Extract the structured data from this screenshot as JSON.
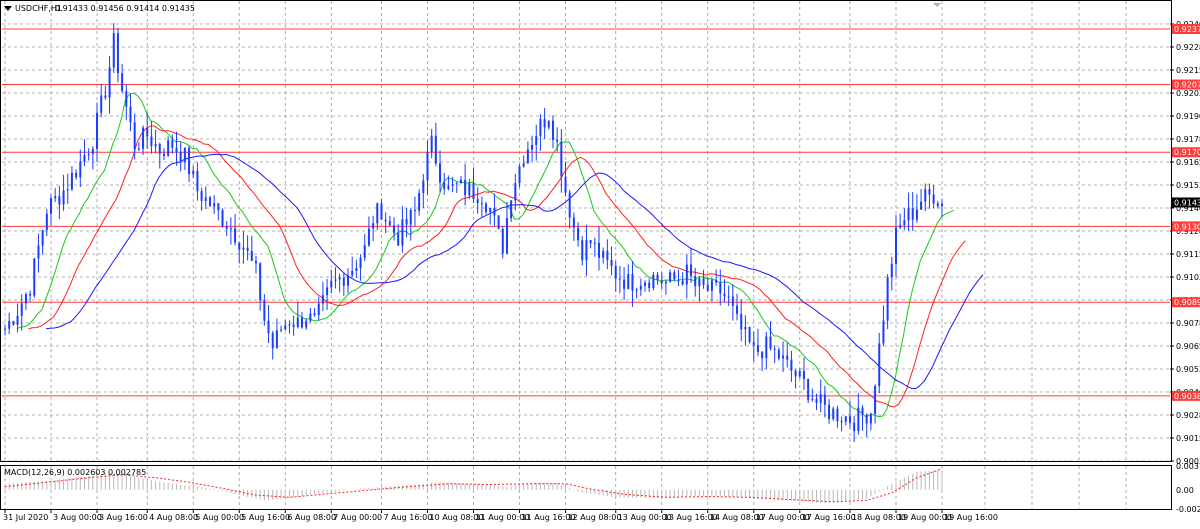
{
  "header": {
    "symbol": "USDCHF,H1",
    "ohlc": "0.91433 0.91456 0.91414 0.91435"
  },
  "colors": {
    "candles": "#1a3cff",
    "ma_fast": "#19c819",
    "ma_mid": "#ff2020",
    "ma_slow": "#1a1aff",
    "hline": "#ff3b3b",
    "current_tag": "#000000",
    "macd_hist": "#b8b8b8",
    "macd_signal": "#ff2020"
  },
  "chart_data": [
    {
      "type": "candlestick",
      "title": "USDCHF,H1",
      "ylim": [
        0.9003,
        0.9253
      ],
      "y_ticks": [
        "0.92405",
        "0.92280",
        "0.92155",
        "0.92030",
        "0.91905",
        "0.91780",
        "0.91655",
        "0.91530",
        "0.91405",
        "0.91280",
        "0.91155",
        "0.91030",
        "0.90905",
        "0.90780",
        "0.90655",
        "0.90530",
        "0.90405",
        "0.90280",
        "0.90155",
        "0.90030"
      ],
      "x_ticks": [
        "31 Jul 2020",
        "3 Aug 00:00",
        "3 Aug 16:00",
        "4 Aug 08:00",
        "5 Aug 00:00",
        "5 Aug 16:00",
        "6 Aug 08:00",
        "7 Aug 00:00",
        "7 Aug 16:00",
        "10 Aug 08:00",
        "11 Aug 00:00",
        "11 Aug 16:00",
        "12 Aug 08:00",
        "13 Aug 00:00",
        "13 Aug 16:00",
        "14 Aug 08:00",
        "17 Aug 00:00",
        "17 Aug 16:00",
        "18 Aug 08:00",
        "19 Aug 00:00",
        "19 Aug 16:00"
      ],
      "grid": true,
      "horizontal_levels": [
        "0.92378",
        "0.92076",
        "0.91708",
        "0.91305",
        "0.90893",
        "0.90384"
      ],
      "current_price": "0.91435",
      "close_path": [
        [
          0,
          0.9075
        ],
        [
          3,
          0.9085
        ],
        [
          6,
          0.9098
        ],
        [
          10,
          0.914
        ],
        [
          14,
          0.915
        ],
        [
          18,
          0.9165
        ],
        [
          21,
          0.9178
        ],
        [
          24,
          0.9205
        ],
        [
          26,
          0.923
        ],
        [
          28,
          0.9205
        ],
        [
          31,
          0.9175
        ],
        [
          34,
          0.918
        ],
        [
          37,
          0.9172
        ],
        [
          40,
          0.9175
        ],
        [
          43,
          0.9168
        ],
        [
          46,
          0.915
        ],
        [
          50,
          0.914
        ],
        [
          54,
          0.913
        ],
        [
          57,
          0.912
        ],
        [
          60,
          0.9105
        ],
        [
          62,
          0.908
        ],
        [
          64,
          0.9065
        ],
        [
          66,
          0.9075
        ],
        [
          68,
          0.908
        ],
        [
          70,
          0.9078
        ],
        [
          72,
          0.9082
        ],
        [
          74,
          0.9078
        ],
        [
          76,
          0.9088
        ],
        [
          78,
          0.9098
        ],
        [
          80,
          0.9102
        ],
        [
          83,
          0.9108
        ],
        [
          86,
          0.9118
        ],
        [
          88,
          0.9135
        ],
        [
          90,
          0.914
        ],
        [
          92,
          0.913
        ],
        [
          94,
          0.9125
        ],
        [
          96,
          0.9132
        ],
        [
          98,
          0.9138
        ],
        [
          100,
          0.916
        ],
        [
          102,
          0.9175
        ],
        [
          104,
          0.916
        ],
        [
          106,
          0.915
        ],
        [
          108,
          0.9152
        ],
        [
          111,
          0.915
        ],
        [
          114,
          0.9148
        ],
        [
          116,
          0.914
        ],
        [
          118,
          0.9125
        ],
        [
          119,
          0.912
        ],
        [
          121,
          0.915
        ],
        [
          124,
          0.917
        ],
        [
          127,
          0.9182
        ],
        [
          130,
          0.9192
        ],
        [
          132,
          0.9175
        ],
        [
          134,
          0.915
        ],
        [
          136,
          0.913
        ],
        [
          138,
          0.9118
        ],
        [
          140,
          0.9122
        ],
        [
          143,
          0.9112
        ],
        [
          146,
          0.9105
        ],
        [
          149,
          0.91
        ],
        [
          152,
          0.9102
        ],
        [
          155,
          0.9103
        ],
        [
          158,
          0.91
        ],
        [
          161,
          0.9102
        ],
        [
          163,
          0.9105
        ],
        [
          165,
          0.9098
        ],
        [
          168,
          0.9096
        ],
        [
          171,
          0.9095
        ],
        [
          173,
          0.909
        ],
        [
          175,
          0.9078
        ],
        [
          177,
          0.907
        ],
        [
          179,
          0.9062
        ],
        [
          182,
          0.9065
        ],
        [
          185,
          0.906
        ],
        [
          188,
          0.9052
        ],
        [
          191,
          0.9045
        ],
        [
          194,
          0.9035
        ],
        [
          197,
          0.903
        ],
        [
          200,
          0.9028
        ],
        [
          203,
          0.9025
        ],
        [
          205,
          0.9028
        ],
        [
          207,
          0.903
        ],
        [
          209,
          0.9065
        ],
        [
          211,
          0.91
        ],
        [
          213,
          0.9125
        ],
        [
          215,
          0.9135
        ],
        [
          217,
          0.9138
        ],
        [
          219,
          0.9145
        ],
        [
          222,
          0.9148
        ],
        [
          224,
          0.9143
        ]
      ],
      "series": [
        {
          "name": "MA fast",
          "color": "#19c819"
        },
        {
          "name": "MA mid",
          "color": "#ff2020"
        },
        {
          "name": "MA slow",
          "color": "#1a1aff"
        }
      ]
    },
    {
      "type": "macd",
      "title": "MACD(12,26,9) 0.002603 0.002785",
      "y_ticks": [
        "0.003156",
        "0.00",
        "-0.00255"
      ],
      "ylim": [
        -0.00255,
        0.003156
      ],
      "hist_path": [
        [
          0,
          0.0008
        ],
        [
          10,
          0.0012
        ],
        [
          20,
          0.0018
        ],
        [
          26,
          0.0022
        ],
        [
          32,
          0.0016
        ],
        [
          40,
          0.0008
        ],
        [
          50,
          0.0001
        ],
        [
          56,
          -0.0007
        ],
        [
          62,
          -0.0014
        ],
        [
          68,
          -0.0011
        ],
        [
          76,
          -0.0004
        ],
        [
          86,
          0.0002
        ],
        [
          96,
          0.0006
        ],
        [
          104,
          0.001
        ],
        [
          112,
          0.0008
        ],
        [
          120,
          0.0004
        ],
        [
          128,
          0.001
        ],
        [
          132,
          0.0009
        ],
        [
          138,
          -0.0004
        ],
        [
          146,
          -0.001
        ],
        [
          156,
          -0.0011
        ],
        [
          166,
          -0.0008
        ],
        [
          176,
          -0.001
        ],
        [
          186,
          -0.0014
        ],
        [
          196,
          -0.0018
        ],
        [
          206,
          -0.0012
        ],
        [
          212,
          0.0008
        ],
        [
          218,
          0.0024
        ],
        [
          224,
          0.0026
        ]
      ],
      "signal_path": [
        [
          0,
          0.0004
        ],
        [
          10,
          0.001
        ],
        [
          20,
          0.0016
        ],
        [
          28,
          0.002
        ],
        [
          36,
          0.0016
        ],
        [
          44,
          0.001
        ],
        [
          52,
          0.0002
        ],
        [
          60,
          -0.0007
        ],
        [
          68,
          -0.001
        ],
        [
          76,
          -0.0006
        ],
        [
          86,
          -0.0001
        ],
        [
          96,
          0.0004
        ],
        [
          106,
          0.0008
        ],
        [
          116,
          0.0007
        ],
        [
          126,
          0.0008
        ],
        [
          134,
          0.0008
        ],
        [
          140,
          0.0001
        ],
        [
          148,
          -0.0006
        ],
        [
          158,
          -0.001
        ],
        [
          168,
          -0.0009
        ],
        [
          178,
          -0.001
        ],
        [
          188,
          -0.0013
        ],
        [
          198,
          -0.0016
        ],
        [
          206,
          -0.0014
        ],
        [
          212,
          -0.0004
        ],
        [
          218,
          0.0016
        ],
        [
          224,
          0.0028
        ]
      ]
    }
  ]
}
